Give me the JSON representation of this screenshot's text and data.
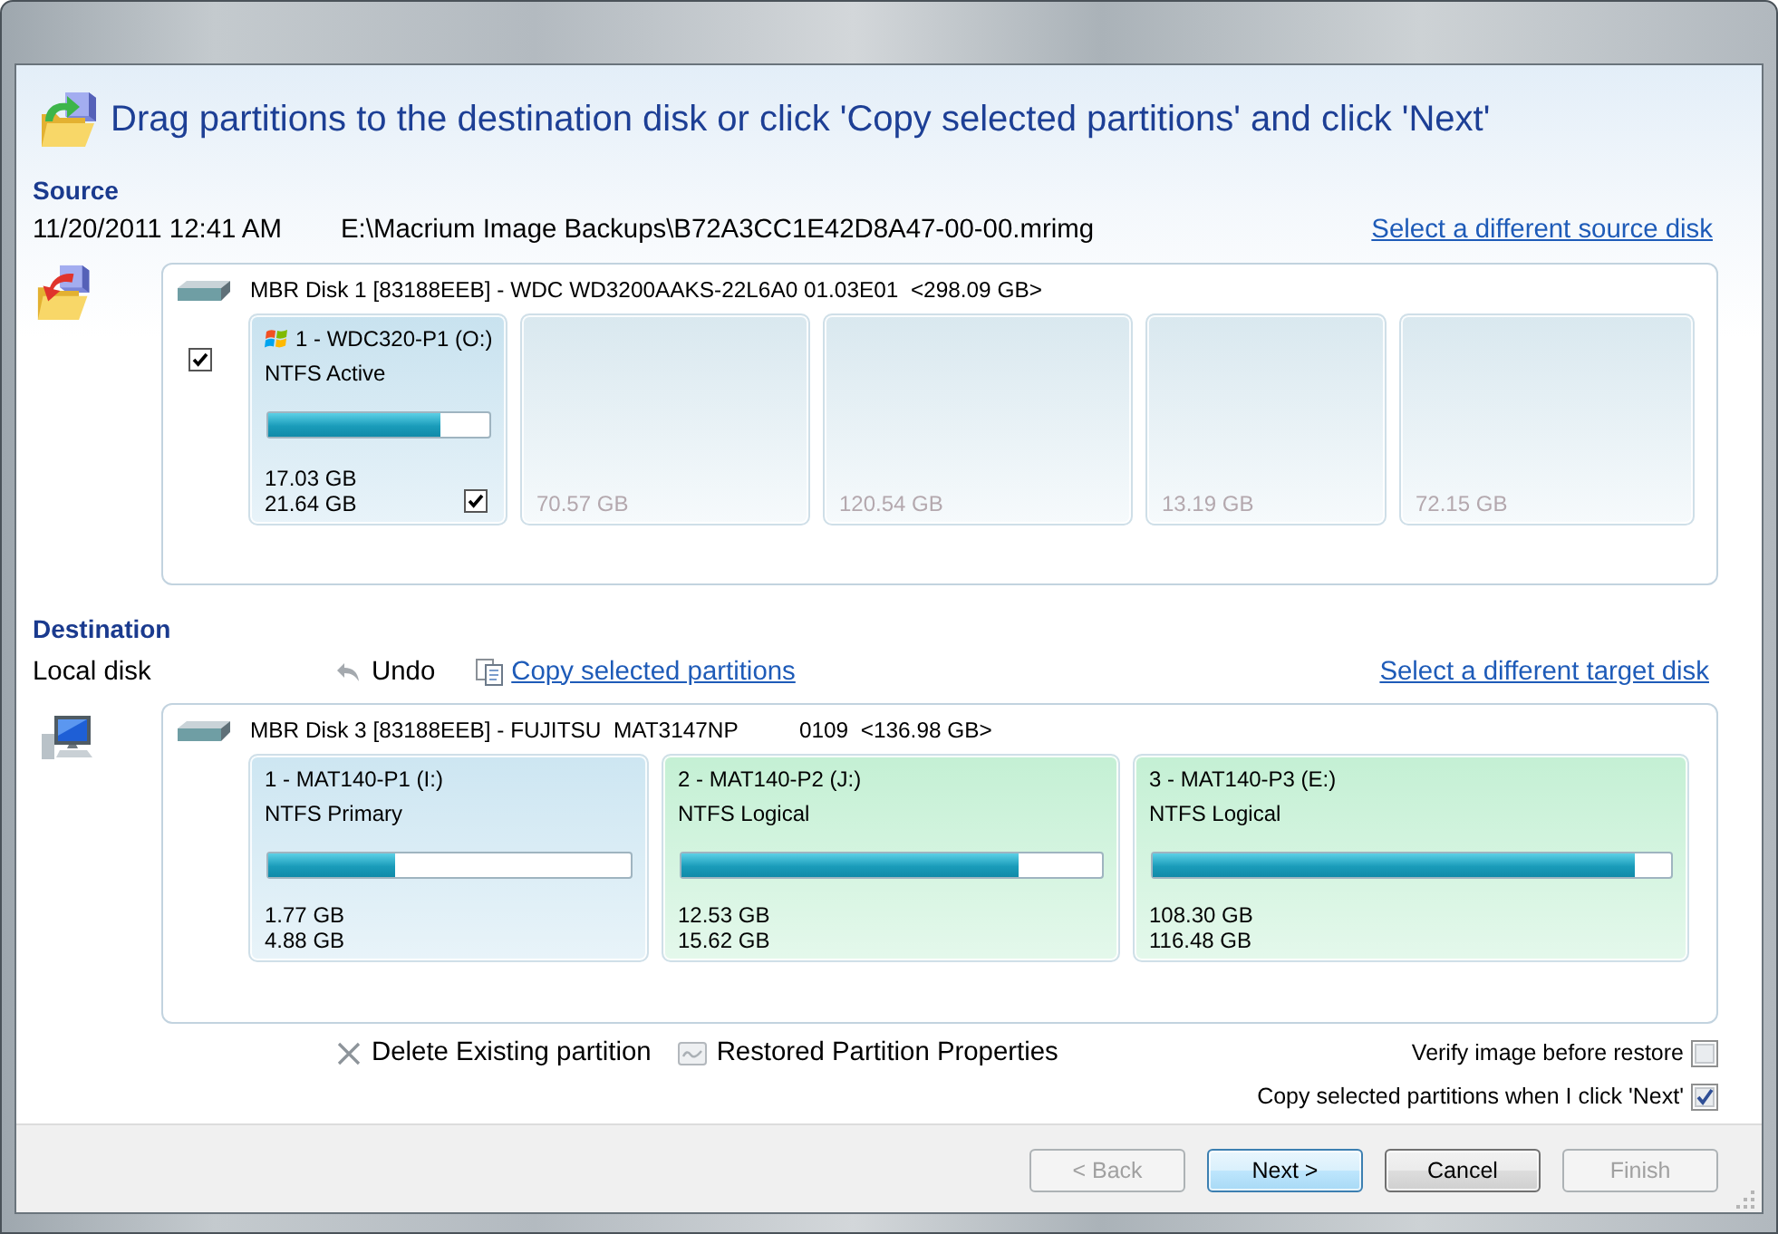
{
  "title": "Drag partitions to the destination disk or click 'Copy selected partitions' and click 'Next'",
  "source": {
    "heading": "Source",
    "date": "11/20/2011 12:41 AM",
    "path": "E:\\Macrium Image Backups\\B72A3CC1E42D8A47-00-00.mrimg",
    "link": "Select a different source disk",
    "disk": {
      "label": "MBR Disk 1 [83188EEB] - WDC WD3200AAKS-22L6A0 01.03E01  <298.09 GB>",
      "checked": true,
      "partitions": [
        {
          "name": "1 - WDC320-P1 (O:)",
          "system": true,
          "type": "NTFS Active",
          "level": 0.78,
          "used": "17.03 GB",
          "size": "21.64 GB",
          "checked": true,
          "disabled": false
        },
        {
          "size": "70.57 GB",
          "disabled": true
        },
        {
          "size": "120.54 GB",
          "disabled": true
        },
        {
          "size": "13.19 GB",
          "disabled": true
        },
        {
          "size": "72.15 GB",
          "disabled": true
        }
      ]
    }
  },
  "destination": {
    "heading": "Destination",
    "label": "Local disk",
    "toolbar": [
      {
        "kind": "undo",
        "label": "Undo"
      },
      {
        "kind": "copy",
        "label": "Copy selected partitions"
      }
    ],
    "link": "Select a different target disk",
    "disk": {
      "label": "MBR Disk 3 [83188EEB] - FUJITSU  MAT3147NP          0109  <136.98 GB>",
      "partitions": [
        {
          "name": "1 - MAT140-P1 (I:)",
          "type": "NTFS Primary",
          "level": 0.35,
          "used": "1.77 GB",
          "size": "4.88 GB",
          "color": "#cde6f2"
        },
        {
          "name": "2 - MAT140-P2 (J:)",
          "type": "NTFS Logical",
          "level": 0.8,
          "used": "12.53 GB",
          "size": "15.62 GB",
          "color": "#c4f0d4"
        },
        {
          "name": "3 - MAT140-P3 (E:)",
          "type": "NTFS Logical",
          "level": 0.93,
          "used": "108.30 GB",
          "size": "116.48 GB",
          "color": "#c4f0d4"
        }
      ]
    }
  },
  "actions": [
    {
      "kind": "delete",
      "label": "Delete Existing partition"
    },
    {
      "kind": "properties",
      "label": "Restored Partition Properties"
    }
  ],
  "options": [
    {
      "label": "Verify image before restore",
      "checked": false
    },
    {
      "label": "Copy selected partitions when I click 'Next'",
      "checked": true
    }
  ],
  "buttons": [
    {
      "label": "< Back",
      "disabled": true,
      "focused": false
    },
    {
      "label": "Next >",
      "disabled": false,
      "focused": true
    },
    {
      "label": "Cancel",
      "disabled": false,
      "focused": false
    },
    {
      "label": "Finish",
      "disabled": true,
      "focused": false
    }
  ]
}
